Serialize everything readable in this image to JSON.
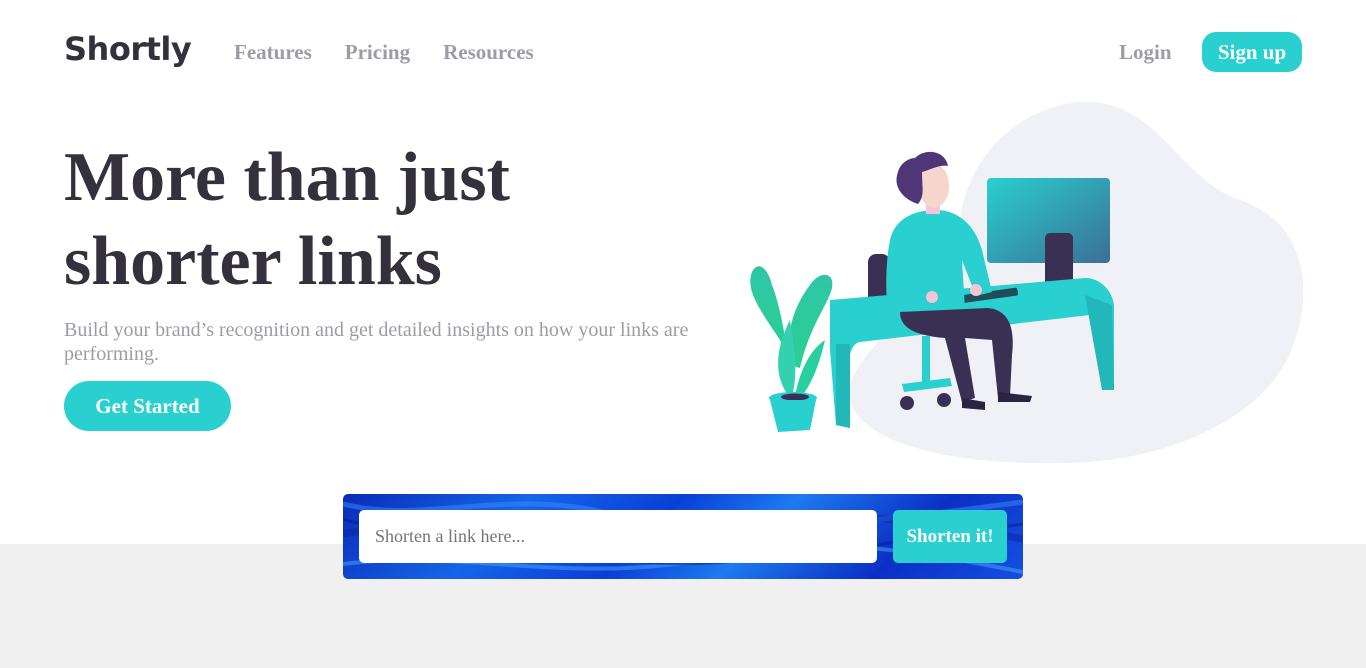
{
  "header": {
    "logo": "Shortly",
    "nav": [
      {
        "label": "Features"
      },
      {
        "label": "Pricing"
      },
      {
        "label": "Resources"
      }
    ],
    "login_label": "Login",
    "signup_label": "Sign up"
  },
  "hero": {
    "title_line1": "More than just",
    "title_line2": "shorter links",
    "subtitle": "Build your brand’s recognition and get detailed insights on how your links are performing.",
    "cta_label": "Get Started"
  },
  "shorten": {
    "placeholder": "Shorten a link here...",
    "value": "",
    "button_label": "Shorten it!"
  },
  "colors": {
    "accent": "#2acfcf",
    "dark": "#34313d",
    "gray": "#9e9aa8",
    "blob": "#f0f1f6",
    "band": "#f0f0f0"
  },
  "icons": {
    "illustration": "person-working-at-desk-illustration"
  }
}
